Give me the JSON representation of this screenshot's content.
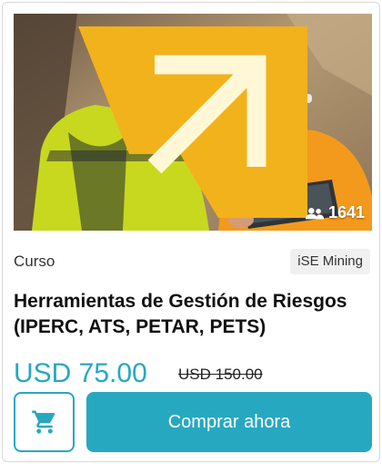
{
  "course": {
    "students_count": "1641",
    "category": "Curso",
    "provider": "iSE Mining",
    "title": "Herramientas de Gestión de Riesgos (IPERC, ATS, PETAR, PETS)",
    "price": "USD 75.00",
    "original_price": "USD 150.00"
  },
  "actions": {
    "buy_label": "Comprar ahora",
    "cart_icon": "shopping-cart-icon"
  },
  "colors": {
    "accent": "#27a8c1",
    "badge_bg": "#f0f0f0",
    "corner_badge": "#f2b21b"
  }
}
